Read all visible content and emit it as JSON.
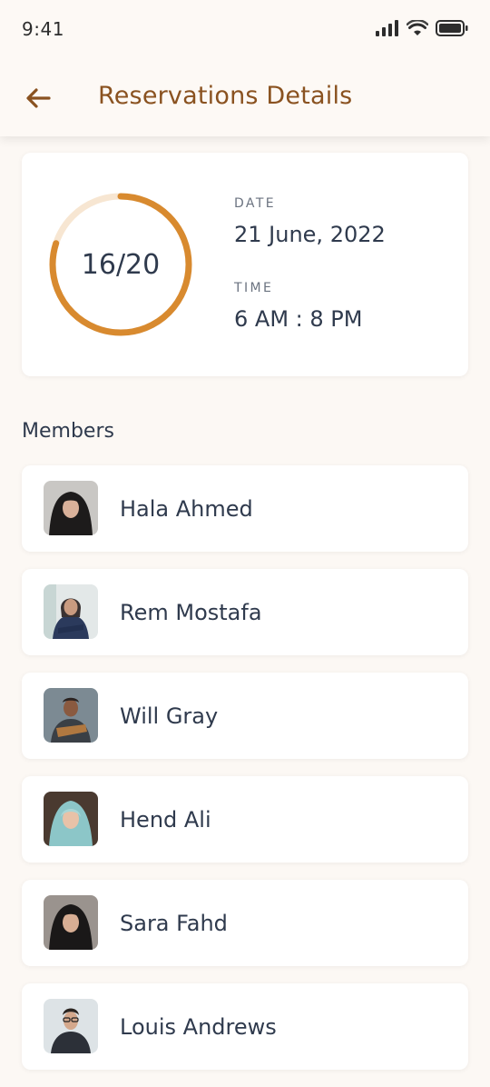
{
  "status_bar": {
    "time": "9:41",
    "icons": [
      "signal-icon",
      "wifi-icon",
      "battery-icon"
    ]
  },
  "header": {
    "back_icon": "arrow-left-icon",
    "title": "Reservations Details"
  },
  "summary": {
    "progress_text": "16/20",
    "booked": 16,
    "capacity": 20,
    "date_label": "DATE",
    "date_value": "21 June, 2022",
    "time_label": "TIME",
    "time_value": "6 AM : 8 PM"
  },
  "members": {
    "heading": "Members",
    "items": [
      {
        "name": "Hala Ahmed"
      },
      {
        "name": "Rem Mostafa"
      },
      {
        "name": "Will Gray"
      },
      {
        "name": "Hend Ali"
      },
      {
        "name": "Sara Fahd"
      },
      {
        "name": "Louis Andrews"
      }
    ]
  },
  "colors": {
    "accent": "#d88a2f",
    "accent_light": "#f7e6d2",
    "title": "#8a5220",
    "text": "#2f3a4d",
    "background": "#fcf8f4"
  }
}
